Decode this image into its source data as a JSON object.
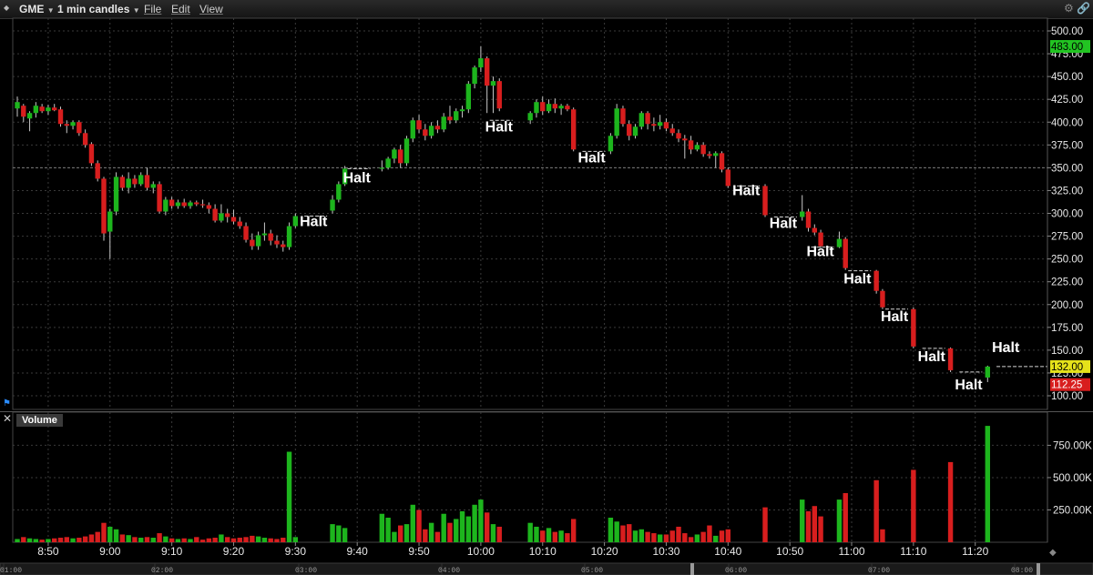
{
  "toolbar": {
    "symbol": "GME",
    "interval": "1 min candles",
    "menu": [
      "File",
      "Edit",
      "View"
    ]
  },
  "price_axis": {
    "ticks": [
      "500.00",
      "475.00",
      "450.00",
      "425.00",
      "400.00",
      "375.00",
      "350.00",
      "325.00",
      "300.00",
      "275.00",
      "250.00",
      "225.00",
      "200.00",
      "175.00",
      "150.00",
      "125.00",
      "100.00"
    ],
    "markers": [
      {
        "label": "483.00",
        "value": 483,
        "bg": "#22c422",
        "fg": "#000000"
      },
      {
        "label": "132.00",
        "value": 132,
        "bg": "#e5e21a",
        "fg": "#000000"
      },
      {
        "label": "112.25",
        "value": 112.25,
        "bg": "#d81e1e",
        "fg": "#ffffff"
      }
    ]
  },
  "volume_pane": {
    "title": "Volume",
    "close_glyph": "✕",
    "ticks": [
      "750.00K",
      "500.00K",
      "250.00K"
    ]
  },
  "time_axis": {
    "labels": [
      "8:50",
      "9:00",
      "9:10",
      "9:20",
      "9:30",
      "9:40",
      "9:50",
      "10:00",
      "10:10",
      "10:20",
      "10:30",
      "10:40",
      "10:50",
      "11:00",
      "11:10",
      "11:20"
    ]
  },
  "navigator": {
    "labels": [
      "01:00",
      "02:00",
      "03:00",
      "04:00",
      "05:00",
      "06:00",
      "07:00",
      "08:00"
    ]
  },
  "halt_text": "Halt",
  "colors": {
    "up": "#1db51d",
    "down": "#d81e1e",
    "doji": "#e5e21a",
    "grid": "#3a3a3a",
    "background": "#000000"
  },
  "chart_data": {
    "type": "candlestick",
    "title": "GME",
    "interval": "1 min candles",
    "ylim": [
      100,
      500
    ],
    "volume_ylim": [
      0,
      950000
    ],
    "x_range": [
      "8:45",
      "11:28"
    ],
    "halts": [
      {
        "time": "9:31",
        "halt_price": 297,
        "label_price": 286
      },
      {
        "time": "9:38",
        "halt_price": 349,
        "label_price": 334
      },
      {
        "time": "10:01",
        "halt_price": 402,
        "label_price": 390
      },
      {
        "time": "10:16",
        "halt_price": 368,
        "label_price": 356
      },
      {
        "time": "10:41",
        "halt_price": 330,
        "label_price": 320
      },
      {
        "time": "10:47",
        "halt_price": 296,
        "label_price": 284
      },
      {
        "time": "10:53",
        "halt_price": 263,
        "label_price": 253
      },
      {
        "time": "10:59",
        "halt_price": 237,
        "label_price": 223
      },
      {
        "time": "11:05",
        "halt_price": 195,
        "label_price": 182
      },
      {
        "time": "11:11",
        "halt_price": 152,
        "label_price": 138
      },
      {
        "time": "11:17",
        "halt_price": 126,
        "label_price": 107
      },
      {
        "time": "11:23",
        "halt_price": 132,
        "label_price": 148
      }
    ],
    "candles": [
      {
        "t": "8:45",
        "o": 415,
        "h": 428,
        "l": 406,
        "c": 422,
        "v": 25000
      },
      {
        "t": "8:46",
        "o": 418,
        "h": 420,
        "l": 400,
        "c": 406,
        "v": 40000
      },
      {
        "t": "8:47",
        "o": 404,
        "h": 412,
        "l": 390,
        "c": 410,
        "v": 30000
      },
      {
        "t": "8:48",
        "o": 410,
        "h": 422,
        "l": 405,
        "c": 418,
        "v": 25000
      },
      {
        "t": "8:49",
        "o": 417,
        "h": 420,
        "l": 410,
        "c": 412,
        "v": 20000
      },
      {
        "t": "8:50",
        "o": 412,
        "h": 419,
        "l": 408,
        "c": 416,
        "v": 25000
      },
      {
        "t": "8:51",
        "o": 416,
        "h": 420,
        "l": 412,
        "c": 413,
        "v": 30000
      },
      {
        "t": "8:52",
        "o": 414,
        "h": 417,
        "l": 395,
        "c": 398,
        "v": 35000
      },
      {
        "t": "8:53",
        "o": 398,
        "h": 402,
        "l": 388,
        "c": 396,
        "v": 40000
      },
      {
        "t": "8:54",
        "o": 396,
        "h": 402,
        "l": 392,
        "c": 400,
        "v": 30000
      },
      {
        "t": "8:55",
        "o": 400,
        "h": 402,
        "l": 385,
        "c": 388,
        "v": 35000
      },
      {
        "t": "8:56",
        "o": 388,
        "h": 392,
        "l": 372,
        "c": 375,
        "v": 45000
      },
      {
        "t": "8:57",
        "o": 376,
        "h": 378,
        "l": 352,
        "c": 355,
        "v": 60000
      },
      {
        "t": "8:58",
        "o": 355,
        "h": 358,
        "l": 335,
        "c": 338,
        "v": 80000
      },
      {
        "t": "8:59",
        "o": 338,
        "h": 340,
        "l": 270,
        "c": 278,
        "v": 150000
      },
      {
        "t": "9:00",
        "o": 280,
        "h": 305,
        "l": 250,
        "c": 302,
        "v": 120000
      },
      {
        "t": "9:01",
        "o": 302,
        "h": 345,
        "l": 298,
        "c": 340,
        "v": 100000
      },
      {
        "t": "9:02",
        "o": 340,
        "h": 342,
        "l": 325,
        "c": 328,
        "v": 60000
      },
      {
        "t": "9:03",
        "o": 328,
        "h": 345,
        "l": 322,
        "c": 338,
        "v": 55000
      },
      {
        "t": "9:04",
        "o": 338,
        "h": 342,
        "l": 328,
        "c": 332,
        "v": 40000
      },
      {
        "t": "9:05",
        "o": 332,
        "h": 345,
        "l": 330,
        "c": 342,
        "v": 35000
      },
      {
        "t": "9:06",
        "o": 342,
        "h": 350,
        "l": 325,
        "c": 328,
        "v": 40000
      },
      {
        "t": "9:07",
        "o": 328,
        "h": 335,
        "l": 322,
        "c": 332,
        "v": 35000
      },
      {
        "t": "9:08",
        "o": 332,
        "h": 335,
        "l": 300,
        "c": 302,
        "v": 70000
      },
      {
        "t": "9:09",
        "o": 302,
        "h": 318,
        "l": 298,
        "c": 315,
        "v": 45000
      },
      {
        "t": "9:10",
        "o": 315,
        "h": 318,
        "l": 305,
        "c": 308,
        "v": 30000
      },
      {
        "t": "9:11",
        "o": 308,
        "h": 315,
        "l": 305,
        "c": 312,
        "v": 25000
      },
      {
        "t": "9:12",
        "o": 312,
        "h": 316,
        "l": 306,
        "c": 308,
        "v": 30000
      },
      {
        "t": "9:13",
        "o": 308,
        "h": 314,
        "l": 305,
        "c": 312,
        "v": 25000
      },
      {
        "t": "9:14",
        "o": 312,
        "h": 314,
        "l": 308,
        "c": 310,
        "v": 40000
      },
      {
        "t": "9:15",
        "o": 310,
        "h": 315,
        "l": 306,
        "c": 309,
        "v": 20000
      },
      {
        "t": "9:16",
        "o": 309,
        "h": 312,
        "l": 300,
        "c": 305,
        "v": 30000
      },
      {
        "t": "9:17",
        "o": 305,
        "h": 310,
        "l": 290,
        "c": 292,
        "v": 35000
      },
      {
        "t": "9:18",
        "o": 292,
        "h": 310,
        "l": 290,
        "c": 300,
        "v": 60000
      },
      {
        "t": "9:19",
        "o": 300,
        "h": 305,
        "l": 290,
        "c": 296,
        "v": 40000
      },
      {
        "t": "9:20",
        "o": 296,
        "h": 304,
        "l": 288,
        "c": 291,
        "v": 30000
      },
      {
        "t": "9:21",
        "o": 291,
        "h": 296,
        "l": 283,
        "c": 286,
        "v": 35000
      },
      {
        "t": "9:22",
        "o": 286,
        "h": 290,
        "l": 268,
        "c": 271,
        "v": 40000
      },
      {
        "t": "9:23",
        "o": 271,
        "h": 278,
        "l": 260,
        "c": 264,
        "v": 50000
      },
      {
        "t": "9:24",
        "o": 264,
        "h": 280,
        "l": 260,
        "c": 276,
        "v": 45000
      },
      {
        "t": "9:25",
        "o": 276,
        "h": 290,
        "l": 270,
        "c": 278,
        "v": 35000
      },
      {
        "t": "9:26",
        "o": 278,
        "h": 282,
        "l": 265,
        "c": 270,
        "v": 30000
      },
      {
        "t": "9:27",
        "o": 270,
        "h": 276,
        "l": 262,
        "c": 266,
        "v": 25000
      },
      {
        "t": "9:28",
        "o": 266,
        "h": 270,
        "l": 258,
        "c": 263,
        "v": 35000
      },
      {
        "t": "9:29",
        "o": 263,
        "h": 290,
        "l": 260,
        "c": 286,
        "v": 700000
      },
      {
        "t": "9:30",
        "o": 286,
        "h": 300,
        "l": 284,
        "c": 297,
        "v": 40000
      },
      {
        "t": "9:36",
        "o": 303,
        "h": 320,
        "l": 300,
        "c": 315,
        "v": 140000
      },
      {
        "t": "9:37",
        "o": 315,
        "h": 335,
        "l": 312,
        "c": 332,
        "v": 130000
      },
      {
        "t": "9:38",
        "o": 332,
        "h": 352,
        "l": 330,
        "c": 349,
        "v": 110000
      },
      {
        "t": "9:44",
        "o": 349,
        "h": 358,
        "l": 346,
        "c": 350,
        "v": 220000
      },
      {
        "t": "9:45",
        "o": 350,
        "h": 362,
        "l": 348,
        "c": 360,
        "v": 190000
      },
      {
        "t": "9:46",
        "o": 360,
        "h": 372,
        "l": 355,
        "c": 370,
        "v": 80000
      },
      {
        "t": "9:47",
        "o": 370,
        "h": 375,
        "l": 350,
        "c": 355,
        "v": 130000
      },
      {
        "t": "9:48",
        "o": 355,
        "h": 385,
        "l": 352,
        "c": 382,
        "v": 140000
      },
      {
        "t": "9:49",
        "o": 382,
        "h": 405,
        "l": 378,
        "c": 402,
        "v": 290000
      },
      {
        "t": "9:50",
        "o": 402,
        "h": 408,
        "l": 388,
        "c": 392,
        "v": 250000
      },
      {
        "t": "9:51",
        "o": 392,
        "h": 398,
        "l": 380,
        "c": 385,
        "v": 100000
      },
      {
        "t": "9:52",
        "o": 385,
        "h": 400,
        "l": 382,
        "c": 396,
        "v": 150000
      },
      {
        "t": "9:53",
        "o": 396,
        "h": 402,
        "l": 388,
        "c": 392,
        "v": 80000
      },
      {
        "t": "9:54",
        "o": 392,
        "h": 410,
        "l": 389,
        "c": 406,
        "v": 220000
      },
      {
        "t": "9:55",
        "o": 406,
        "h": 418,
        "l": 398,
        "c": 402,
        "v": 150000
      },
      {
        "t": "9:56",
        "o": 402,
        "h": 415,
        "l": 399,
        "c": 412,
        "v": 180000
      },
      {
        "t": "9:57",
        "o": 412,
        "h": 418,
        "l": 405,
        "c": 414,
        "v": 240000
      },
      {
        "t": "9:58",
        "o": 414,
        "h": 445,
        "l": 410,
        "c": 442,
        "v": 200000
      },
      {
        "t": "9:59",
        "o": 442,
        "h": 462,
        "l": 437,
        "c": 460,
        "v": 290000
      },
      {
        "t": "10:00",
        "o": 460,
        "h": 483,
        "l": 455,
        "c": 470,
        "v": 330000
      },
      {
        "t": "10:01",
        "o": 470,
        "h": 472,
        "l": 410,
        "c": 440,
        "v": 230000
      },
      {
        "t": "10:02",
        "o": 440,
        "h": 450,
        "l": 410,
        "c": 445,
        "v": 140000
      },
      {
        "t": "10:03",
        "o": 445,
        "h": 448,
        "l": 412,
        "c": 415,
        "v": 120000
      },
      {
        "t": "10:08",
        "o": 402,
        "h": 412,
        "l": 398,
        "c": 410,
        "v": 150000
      },
      {
        "t": "10:09",
        "o": 410,
        "h": 425,
        "l": 405,
        "c": 422,
        "v": 120000
      },
      {
        "t": "10:10",
        "o": 422,
        "h": 428,
        "l": 408,
        "c": 412,
        "v": 90000
      },
      {
        "t": "10:11",
        "o": 412,
        "h": 425,
        "l": 410,
        "c": 420,
        "v": 110000
      },
      {
        "t": "10:12",
        "o": 420,
        "h": 426,
        "l": 410,
        "c": 415,
        "v": 80000
      },
      {
        "t": "10:13",
        "o": 415,
        "h": 420,
        "l": 408,
        "c": 418,
        "v": 90000
      },
      {
        "t": "10:14",
        "o": 418,
        "h": 420,
        "l": 412,
        "c": 414,
        "v": 70000
      },
      {
        "t": "10:15",
        "o": 414,
        "h": 416,
        "l": 368,
        "c": 370,
        "v": 180000
      },
      {
        "t": "10:21",
        "o": 368,
        "h": 388,
        "l": 365,
        "c": 385,
        "v": 190000
      },
      {
        "t": "10:22",
        "o": 385,
        "h": 420,
        "l": 382,
        "c": 415,
        "v": 160000
      },
      {
        "t": "10:23",
        "o": 415,
        "h": 418,
        "l": 395,
        "c": 398,
        "v": 130000
      },
      {
        "t": "10:24",
        "o": 398,
        "h": 402,
        "l": 380,
        "c": 385,
        "v": 140000
      },
      {
        "t": "10:25",
        "o": 385,
        "h": 398,
        "l": 382,
        "c": 395,
        "v": 90000
      },
      {
        "t": "10:26",
        "o": 395,
        "h": 412,
        "l": 392,
        "c": 410,
        "v": 100000
      },
      {
        "t": "10:27",
        "o": 410,
        "h": 412,
        "l": 392,
        "c": 398,
        "v": 80000
      },
      {
        "t": "10:28",
        "o": 398,
        "h": 405,
        "l": 390,
        "c": 396,
        "v": 70000
      },
      {
        "t": "10:29",
        "o": 396,
        "h": 408,
        "l": 392,
        "c": 400,
        "v": 60000
      },
      {
        "t": "10:30",
        "o": 400,
        "h": 404,
        "l": 390,
        "c": 393,
        "v": 60000
      },
      {
        "t": "10:31",
        "o": 393,
        "h": 398,
        "l": 385,
        "c": 388,
        "v": 90000
      },
      {
        "t": "10:32",
        "o": 388,
        "h": 392,
        "l": 378,
        "c": 382,
        "v": 120000
      },
      {
        "t": "10:33",
        "o": 382,
        "h": 386,
        "l": 360,
        "c": 380,
        "v": 70000
      },
      {
        "t": "10:34",
        "o": 380,
        "h": 385,
        "l": 365,
        "c": 370,
        "v": 40000
      },
      {
        "t": "10:35",
        "o": 370,
        "h": 378,
        "l": 368,
        "c": 375,
        "v": 60000
      },
      {
        "t": "10:36",
        "o": 375,
        "h": 378,
        "l": 362,
        "c": 365,
        "v": 80000
      },
      {
        "t": "10:37",
        "o": 365,
        "h": 368,
        "l": 360,
        "c": 363,
        "v": 130000
      },
      {
        "t": "10:38",
        "o": 363,
        "h": 368,
        "l": 350,
        "c": 366,
        "v": 50000
      },
      {
        "t": "10:39",
        "o": 366,
        "h": 368,
        "l": 345,
        "c": 348,
        "v": 90000
      },
      {
        "t": "10:40",
        "o": 348,
        "h": 350,
        "l": 328,
        "c": 330,
        "v": 100000
      },
      {
        "t": "10:46",
        "o": 330,
        "h": 332,
        "l": 296,
        "c": 298,
        "v": 270000
      },
      {
        "t": "10:52",
        "o": 296,
        "h": 320,
        "l": 292,
        "c": 302,
        "v": 330000
      },
      {
        "t": "10:53",
        "o": 302,
        "h": 305,
        "l": 280,
        "c": 284,
        "v": 240000
      },
      {
        "t": "10:54",
        "o": 284,
        "h": 288,
        "l": 276,
        "c": 279,
        "v": 280000
      },
      {
        "t": "10:55",
        "o": 279,
        "h": 282,
        "l": 262,
        "c": 264,
        "v": 200000
      },
      {
        "t": "10:58",
        "o": 263,
        "h": 280,
        "l": 262,
        "c": 272,
        "v": 330000
      },
      {
        "t": "10:59",
        "o": 272,
        "h": 274,
        "l": 238,
        "c": 240,
        "v": 380000
      },
      {
        "t": "11:04",
        "o": 237,
        "h": 238,
        "l": 212,
        "c": 215,
        "v": 480000
      },
      {
        "t": "11:05",
        "o": 215,
        "h": 217,
        "l": 195,
        "c": 197,
        "v": 100000
      },
      {
        "t": "11:10",
        "o": 195,
        "h": 197,
        "l": 152,
        "c": 154,
        "v": 560000
      },
      {
        "t": "11:16",
        "o": 152,
        "h": 153,
        "l": 126,
        "c": 128,
        "v": 620000
      },
      {
        "t": "11:22",
        "o": 120,
        "h": 133,
        "l": 115,
        "c": 132,
        "v": 900000
      }
    ]
  }
}
